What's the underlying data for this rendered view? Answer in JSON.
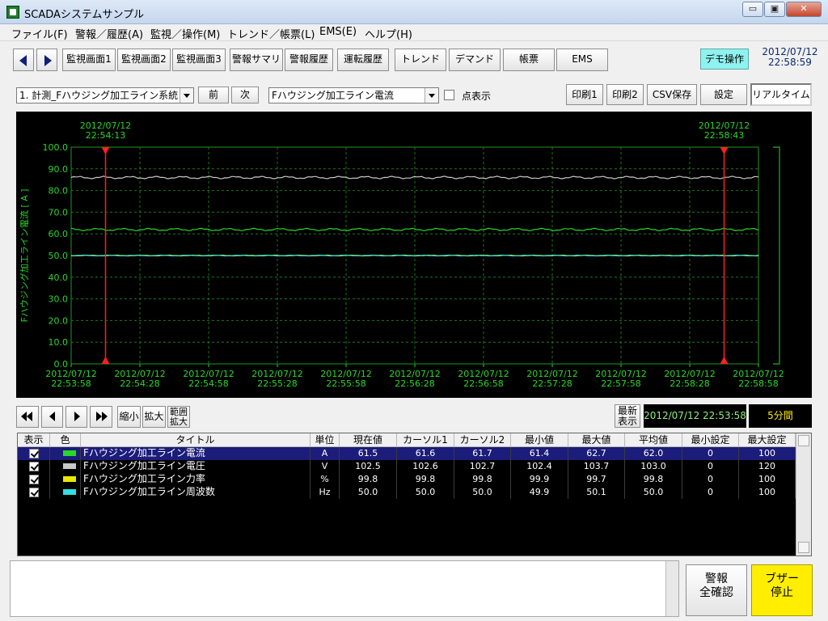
{
  "window": {
    "title": "SCADAシステムサンプル",
    "min_glyph": "▭",
    "max_glyph": "▣",
    "close_glyph": "✕"
  },
  "menu": [
    "ファイル(F)",
    "警報／履歴(A)",
    "監視／操作(M)",
    "トレンド／帳票(L)",
    "EMS(E)",
    "ヘルプ(H)"
  ],
  "toolbar": {
    "buttons": [
      "監視画面1",
      "監視画面2",
      "監視画面3",
      "警報サマリ",
      "警報履歴",
      "運転履歴",
      "トレンド",
      "デマンド",
      "帳票",
      "EMS"
    ],
    "demo": "デモ操作",
    "date": "2012/07/12",
    "time": "22:58:59"
  },
  "filter": {
    "group": "1. 計測_Fハウジング加工ライン系統",
    "prev": "前",
    "next": "次",
    "point": "Fハウジング加工ライン電流",
    "dot_label": "点表示",
    "print1": "印刷1",
    "print2": "印刷2",
    "csv": "CSV保存",
    "settings": "設定",
    "realtime": "リアルタイム"
  },
  "chart_data": {
    "type": "line",
    "ylabel": "Fハウジング加工ライン電流 [ A ]",
    "ylim": [
      0,
      100
    ],
    "yticks": [
      "100.0",
      "90.0",
      "80.0",
      "70.0",
      "60.0",
      "50.0",
      "40.0",
      "30.0",
      "20.0",
      "10.0",
      "0.0"
    ],
    "x_start": "2012/07/12 22:53:58",
    "x_end": "2012/07/12 22:58:58",
    "xticks": [
      {
        "date": "2012/07/12",
        "time": "22:53:58"
      },
      {
        "date": "2012/07/12",
        "time": "22:54:28"
      },
      {
        "date": "2012/07/12",
        "time": "22:54:58"
      },
      {
        "date": "2012/07/12",
        "time": "22:55:28"
      },
      {
        "date": "2012/07/12",
        "time": "22:55:58"
      },
      {
        "date": "2012/07/12",
        "time": "22:56:28"
      },
      {
        "date": "2012/07/12",
        "time": "22:56:58"
      },
      {
        "date": "2012/07/12",
        "time": "22:57:28"
      },
      {
        "date": "2012/07/12",
        "time": "22:57:58"
      },
      {
        "date": "2012/07/12",
        "time": "22:58:28"
      },
      {
        "date": "2012/07/12",
        "time": "22:58:58"
      }
    ],
    "cursors": [
      {
        "date": "2012/07/12",
        "time": "22:54:13"
      },
      {
        "date": "2012/07/12",
        "time": "22:58:43"
      }
    ],
    "series": [
      {
        "name": "Fハウジング加工ライン電圧",
        "color": "#c8c8c8",
        "mean": 86,
        "amp": 0.6
      },
      {
        "name": "Fハウジング加工ライン電流",
        "color": "#28d828",
        "mean": 62,
        "amp": 0.6
      },
      {
        "name": "Fハウジング加工ライン力率",
        "color": "#e8e800",
        "mean": 50,
        "amp": 0.2
      },
      {
        "name": "Fハウジング加工ライン周波数",
        "color": "#30e0e0",
        "mean": 50,
        "amp": 0.2
      }
    ],
    "grid": true
  },
  "nav": {
    "zoom_out": "縮小",
    "zoom_in": "拡大",
    "range_zoom": "範囲\n拡大",
    "latest": "最新\n表示",
    "start_time": "2012/07/12 22:53:58",
    "span": "5分間"
  },
  "table": {
    "headers": [
      "表示",
      "色",
      "タイトル",
      "単位",
      "現在値",
      "カーソル1",
      "カーソル2",
      "最小値",
      "最大値",
      "平均値",
      "最小設定",
      "最大設定"
    ],
    "rows": [
      {
        "color": "#28d828",
        "title": "Fハウジング加工ライン電流",
        "unit": "A",
        "cur": "61.5",
        "c1": "61.6",
        "c2": "61.7",
        "min": "61.4",
        "max": "62.7",
        "avg": "62.0",
        "minset": "0",
        "maxset": "100"
      },
      {
        "color": "#c8c8c8",
        "title": "Fハウジング加工ライン電圧",
        "unit": "V",
        "cur": "102.5",
        "c1": "102.6",
        "c2": "102.7",
        "min": "102.4",
        "max": "103.7",
        "avg": "103.0",
        "minset": "0",
        "maxset": "120"
      },
      {
        "color": "#e8e800",
        "title": "Fハウジング加工ライン力率",
        "unit": "%",
        "cur": "99.8",
        "c1": "99.8",
        "c2": "99.8",
        "min": "99.9",
        "max": "99.7",
        "avg": "99.8",
        "minset": "0",
        "maxset": "100"
      },
      {
        "color": "#30e0e0",
        "title": "Fハウジング加工ライン周波数",
        "unit": "Hz",
        "cur": "50.0",
        "c1": "50.0",
        "c2": "50.0",
        "min": "49.9",
        "max": "50.1",
        "avg": "50.0",
        "minset": "0",
        "maxset": "100"
      }
    ]
  },
  "footer": {
    "ack_all": "警報\n全確認",
    "buzzer_stop": "ブザー\n停止"
  }
}
